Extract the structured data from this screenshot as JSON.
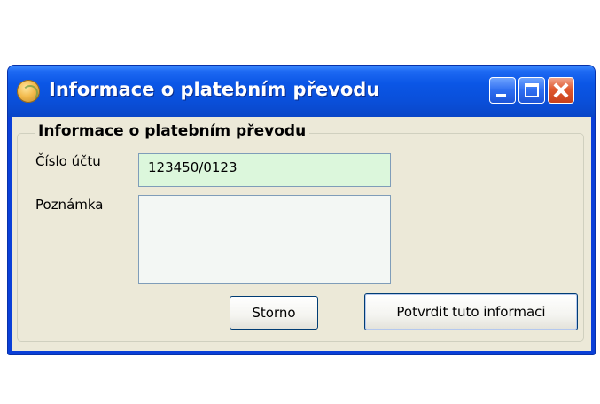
{
  "window": {
    "title": "Informace o platebním převodu"
  },
  "form": {
    "group_title": "Informace o platebním převodu",
    "account_label": "Číslo účtu",
    "account_value": "123450/0123",
    "note_label": "Poznámka",
    "note_value": ""
  },
  "buttons": {
    "cancel_label": "Storno",
    "confirm_label": "Potvrdit tuto informaci"
  },
  "colors": {
    "titlebar": "#0a4fd9",
    "window_body": "#ece9d8",
    "account_field_bg": "#dcf7dc",
    "close_button": "#e0592f"
  },
  "icons": [
    "app-icon",
    "minimize-icon",
    "maximize-icon",
    "close-icon"
  ]
}
